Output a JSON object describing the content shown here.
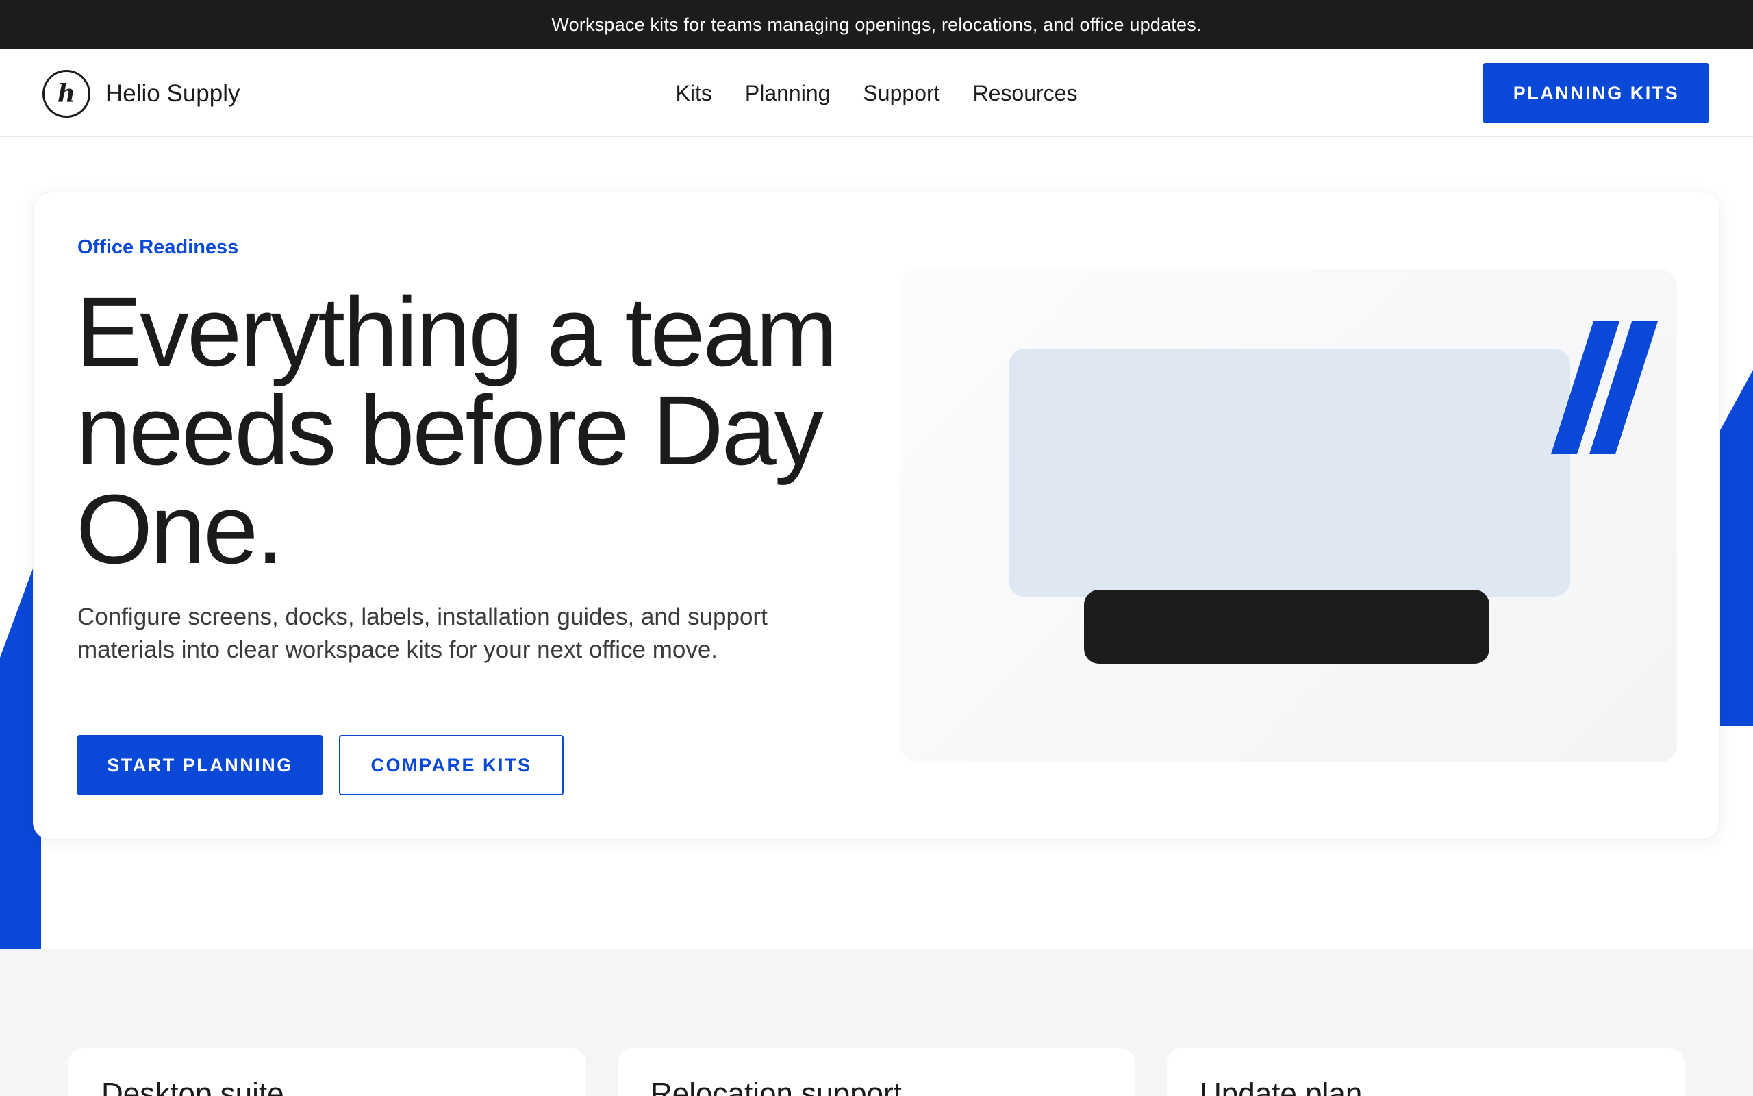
{
  "announcement": "Workspace kits for teams managing openings, relocations, and office updates.",
  "brand": {
    "logo_letter": "h",
    "name": "Helio Supply"
  },
  "nav": {
    "items": [
      {
        "label": "Kits"
      },
      {
        "label": "Planning"
      },
      {
        "label": "Support"
      },
      {
        "label": "Resources"
      }
    ],
    "cta_label": "PLANNING KITS"
  },
  "hero": {
    "eyebrow": "Office Readiness",
    "headline": "Everything a team needs before Day One.",
    "lead": "Configure screens, docks, labels, installation guides, and support materials into clear workspace kits for your next office move.",
    "primary_cta": "START PLANNING",
    "secondary_cta": "COMPARE KITS"
  },
  "features": [
    {
      "title": "Desktop suite"
    },
    {
      "title": "Relocation support"
    },
    {
      "title": "Update plan"
    }
  ],
  "colors": {
    "accent": "#0a48d8",
    "dark": "#1c1c1c",
    "monitor": "#dfe7f3",
    "section_bg": "#f5f5f5"
  }
}
